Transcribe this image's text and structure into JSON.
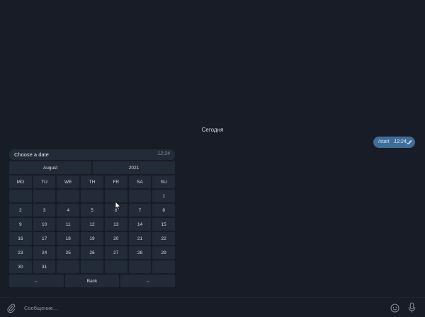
{
  "chat": {
    "date_separator": "Сегодня",
    "outgoing": {
      "text": "/start",
      "time": "12:24"
    },
    "bot": {
      "text": "Choose a date",
      "time": "12:24"
    }
  },
  "keyboard": {
    "month": "August",
    "year": "2021",
    "weekdays": [
      "MO",
      "TU",
      "WE",
      "TH",
      "FR",
      "SA",
      "SU"
    ],
    "weeks": [
      [
        "",
        "",
        "",
        "",
        "",
        "",
        "1"
      ],
      [
        "2",
        "3",
        "4",
        "5",
        "6",
        "7",
        "8"
      ],
      [
        "9",
        "10",
        "11",
        "12",
        "13",
        "14",
        "15"
      ],
      [
        "16",
        "17",
        "18",
        "19",
        "20",
        "21",
        "22"
      ],
      [
        "23",
        "24",
        "25",
        "26",
        "27",
        "28",
        "29"
      ],
      [
        "30",
        "31",
        "",
        "",
        "",
        "",
        ""
      ]
    ],
    "nav": {
      "prev": "←",
      "back": "Back",
      "next": "→"
    }
  },
  "composer": {
    "placeholder": "Сообщение..."
  },
  "icons": {
    "attach": "paperclip-icon",
    "emoji": "emoji-icon",
    "mic": "microphone-icon",
    "read_status": "double-check-icon",
    "pointer": "mouse-cursor"
  },
  "colors": {
    "background": "#181c26",
    "outgoing_bubble": "#3f6d98",
    "incoming_bubble": "#222b38",
    "button": "#222b38"
  }
}
